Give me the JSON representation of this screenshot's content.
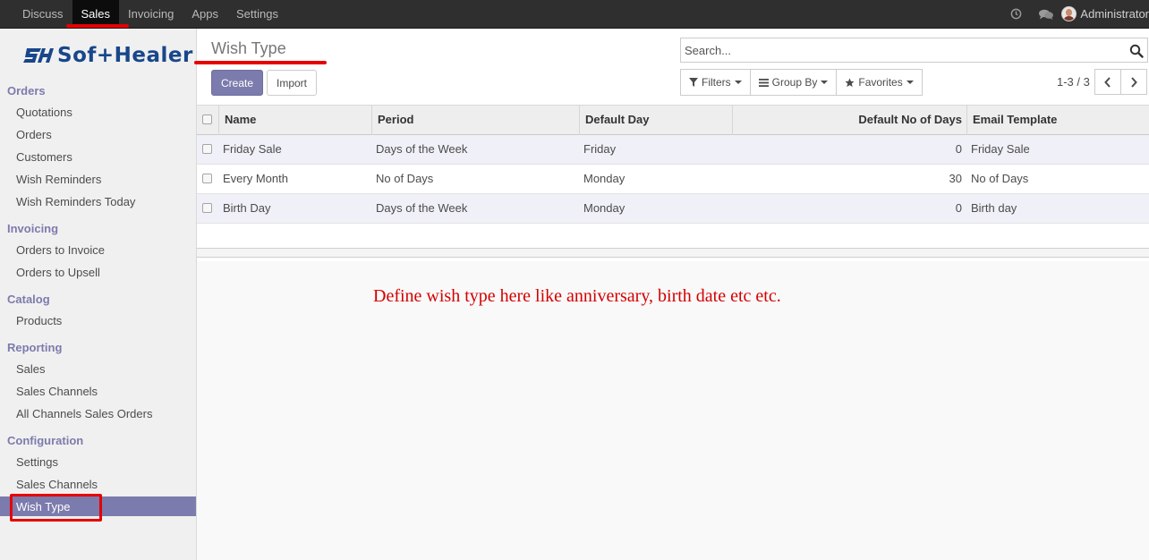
{
  "topbar": {
    "menu": [
      "Discuss",
      "Sales",
      "Invoicing",
      "Apps",
      "Settings"
    ],
    "active": "Sales",
    "user": "Administrator"
  },
  "sidebar": {
    "brand": "Sof+Healer",
    "sections": [
      {
        "title": "Orders",
        "items": [
          "Quotations",
          "Orders",
          "Customers",
          "Wish Reminders",
          "Wish Reminders Today"
        ]
      },
      {
        "title": "Invoicing",
        "items": [
          "Orders to Invoice",
          "Orders to Upsell"
        ]
      },
      {
        "title": "Catalog",
        "items": [
          "Products"
        ]
      },
      {
        "title": "Reporting",
        "items": [
          "Sales",
          "Sales Channels",
          "All Channels Sales Orders"
        ]
      },
      {
        "title": "Configuration",
        "items": [
          "Settings",
          "Sales Channels",
          "Wish Type"
        ]
      }
    ],
    "active_item": "Wish Type"
  },
  "control_panel": {
    "title": "Wish Type",
    "create_label": "Create",
    "import_label": "Import",
    "search_placeholder": "Search...",
    "filters_label": "Filters",
    "groupby_label": "Group By",
    "favorites_label": "Favorites",
    "pager": "1-3 / 3"
  },
  "table": {
    "columns": [
      "Name",
      "Period",
      "Default Day",
      "Default No of Days",
      "Email Template"
    ],
    "rows": [
      [
        "Friday Sale",
        "Days of the Week",
        "Friday",
        "0",
        "Friday Sale"
      ],
      [
        "Every Month",
        "No of Days",
        "Monday",
        "30",
        "No of Days"
      ],
      [
        "Birth Day",
        "Days of the Week",
        "Monday",
        "0",
        "Birth day"
      ]
    ]
  },
  "annotation": "Define wish type here like anniversary, birth date etc etc.",
  "colors": {
    "accent": "#7c7bad",
    "highlight": "#e60000",
    "topbar": "#2f2f2f"
  }
}
